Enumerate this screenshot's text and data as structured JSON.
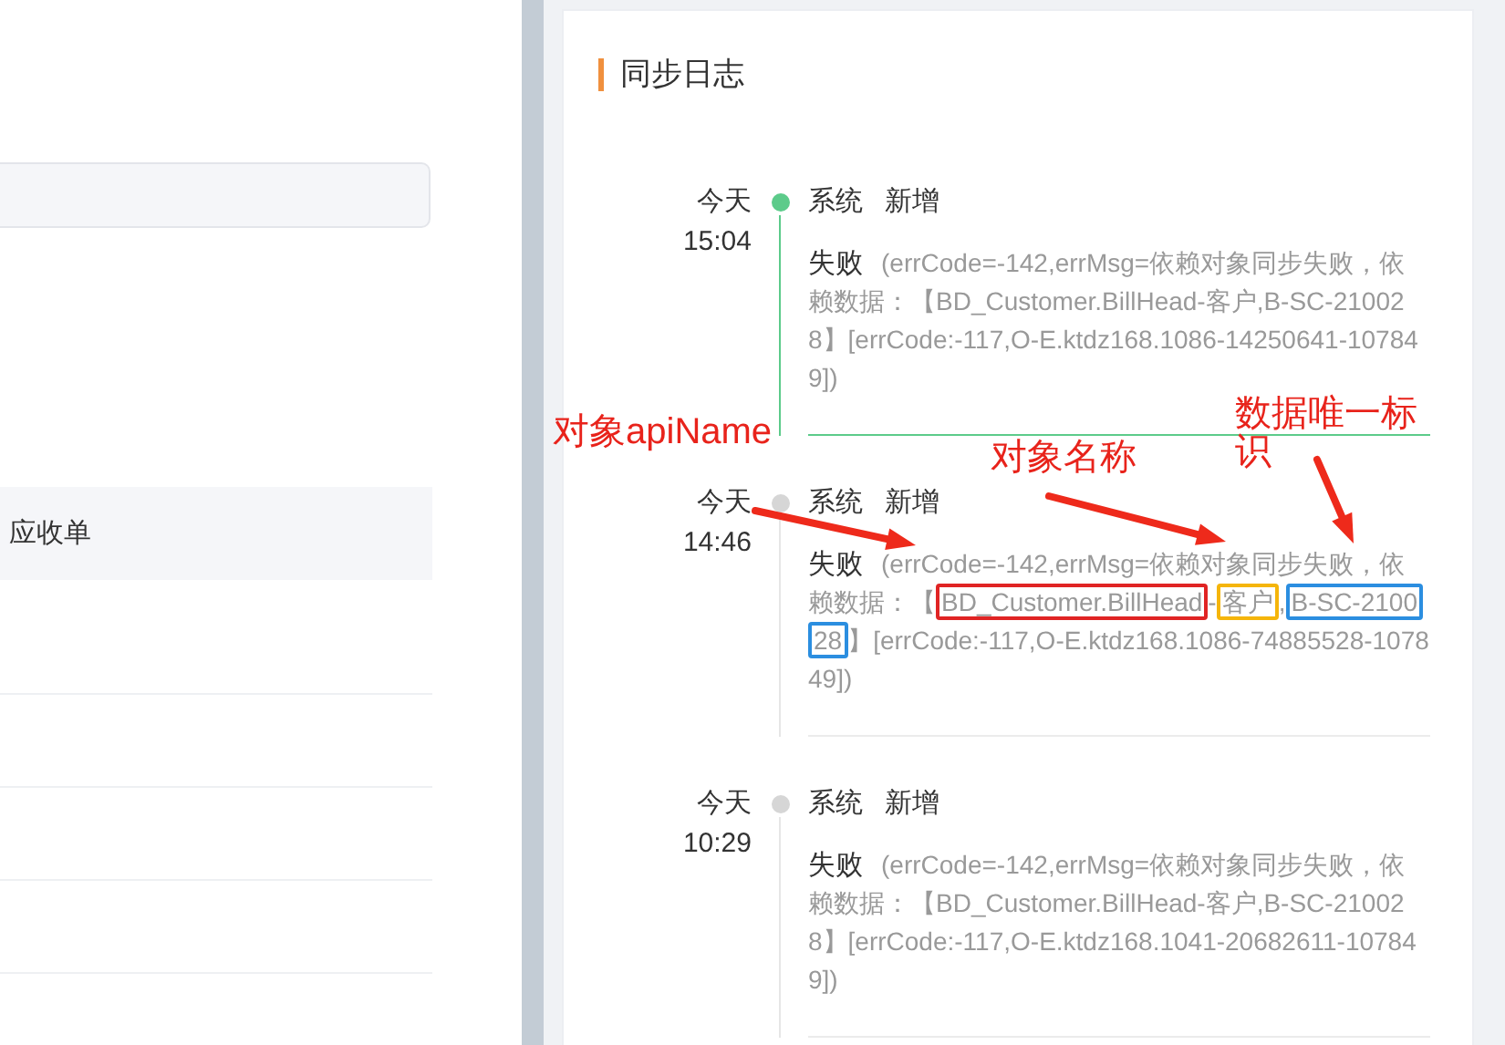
{
  "left_panel": {
    "table": {
      "header": {
        "column_1": "应收单"
      }
    }
  },
  "sync_log": {
    "title": "同步日志",
    "entries": [
      {
        "date": "今天",
        "time": "15:04",
        "operator": "系统",
        "action": "新增",
        "status": "失败",
        "message": [
          {
            "text": "(errCode=-142,errMsg=依赖对象同步失败，依赖数据：【BD_Customer.BillHead-客户,B-SC-210028】[errCode:-117,O-E.ktdz168.1086-14250641-107849])"
          }
        ],
        "selected": true
      },
      {
        "date": "今天",
        "time": "14:46",
        "operator": "系统",
        "action": "新增",
        "status": "失败",
        "message": [
          {
            "text": "(errCode=-142,errMsg=依赖对象同步失败，依赖数据：【"
          },
          {
            "text": "BD_Customer.BillHead",
            "color": "#e02424"
          },
          {
            "text": "-"
          },
          {
            "text": "客户",
            "color": "#f5b50a"
          },
          {
            "text": ","
          },
          {
            "text": "B-SC-210028",
            "color": "#2b8ee0"
          },
          {
            "text": "】[errCode:-117,O-E.ktdz168.1086-74885528-107849])"
          }
        ],
        "selected": false
      },
      {
        "date": "今天",
        "time": "10:29",
        "operator": "系统",
        "action": "新增",
        "status": "失败",
        "message": [
          {
            "text": "(errCode=-142,errMsg=依赖对象同步失败，依赖数据：【BD_Customer.BillHead-客户,B-SC-210028】[errCode:-117,O-E.ktdz168.1041-20682611-107849])"
          }
        ],
        "selected": false
      }
    ]
  },
  "annotations": [
    {
      "kind": "label",
      "text": "对象apiName"
    },
    {
      "kind": "label",
      "text": "对象名称"
    },
    {
      "kind": "label",
      "text": "数据唯一标识"
    },
    {
      "kind": "arrow"
    },
    {
      "kind": "arrow"
    },
    {
      "kind": "arrow"
    }
  ]
}
